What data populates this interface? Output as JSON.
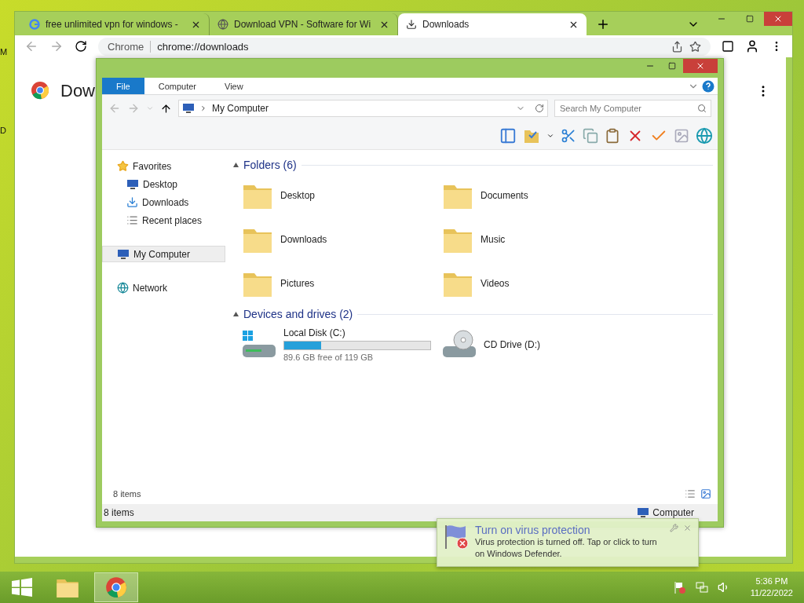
{
  "desktop_labels": [
    "M",
    "D"
  ],
  "browser": {
    "tabs": [
      {
        "title": "free unlimited vpn for windows -",
        "kind": "google",
        "selected": false
      },
      {
        "title": "Download VPN - Software for Wi",
        "kind": "globe",
        "selected": false
      },
      {
        "title": "Downloads",
        "kind": "download",
        "selected": true
      }
    ],
    "address": {
      "chip": "Chrome",
      "url": "chrome://downloads"
    },
    "page_heading": "Dow"
  },
  "explorer": {
    "ribbon_tabs": [
      {
        "label": "File",
        "selected": true
      },
      {
        "label": "Computer",
        "selected": false
      },
      {
        "label": "View",
        "selected": false
      }
    ],
    "address": "My Computer",
    "search_placeholder": "Search My Computer",
    "nav": [
      {
        "label": "Favorites",
        "kind": "favorites",
        "selected": false,
        "children": [
          {
            "label": "Desktop",
            "kind": "desktop",
            "selected": false
          },
          {
            "label": "Downloads",
            "kind": "downloads",
            "selected": false
          },
          {
            "label": "Recent places",
            "kind": "recent",
            "selected": false
          }
        ]
      },
      {
        "label": "My Computer",
        "kind": "computer",
        "selected": true
      },
      {
        "label": "Network",
        "kind": "network",
        "selected": false
      }
    ],
    "groups": [
      {
        "title": "Folders (6)",
        "items": [
          {
            "name": "Desktop",
            "kind": "folder"
          },
          {
            "name": "Documents",
            "kind": "folder"
          },
          {
            "name": "Downloads",
            "kind": "folder"
          },
          {
            "name": "Music",
            "kind": "folder"
          },
          {
            "name": "Pictures",
            "kind": "folder"
          },
          {
            "name": "Videos",
            "kind": "folder"
          }
        ]
      },
      {
        "title": "Devices and drives (2)",
        "items": [
          {
            "name": "Local Disk (C:)",
            "kind": "disk",
            "level": 0.25,
            "free": "89.6 GB free of 119 GB"
          },
          {
            "name": "CD Drive (D:)",
            "kind": "cd"
          }
        ]
      }
    ],
    "item_count": "8 items",
    "status": {
      "count": "8 items",
      "location": "Computer"
    }
  },
  "notification": {
    "title": "Turn on virus protection",
    "body": "Virus protection is turned off. Tap or click to turn on Windows Defender."
  },
  "taskbar": {
    "apps": [
      {
        "kind": "explorer",
        "selected": false
      },
      {
        "kind": "chrome",
        "selected": true
      }
    ],
    "time": "5:36 PM",
    "date": "11/22/2022"
  }
}
